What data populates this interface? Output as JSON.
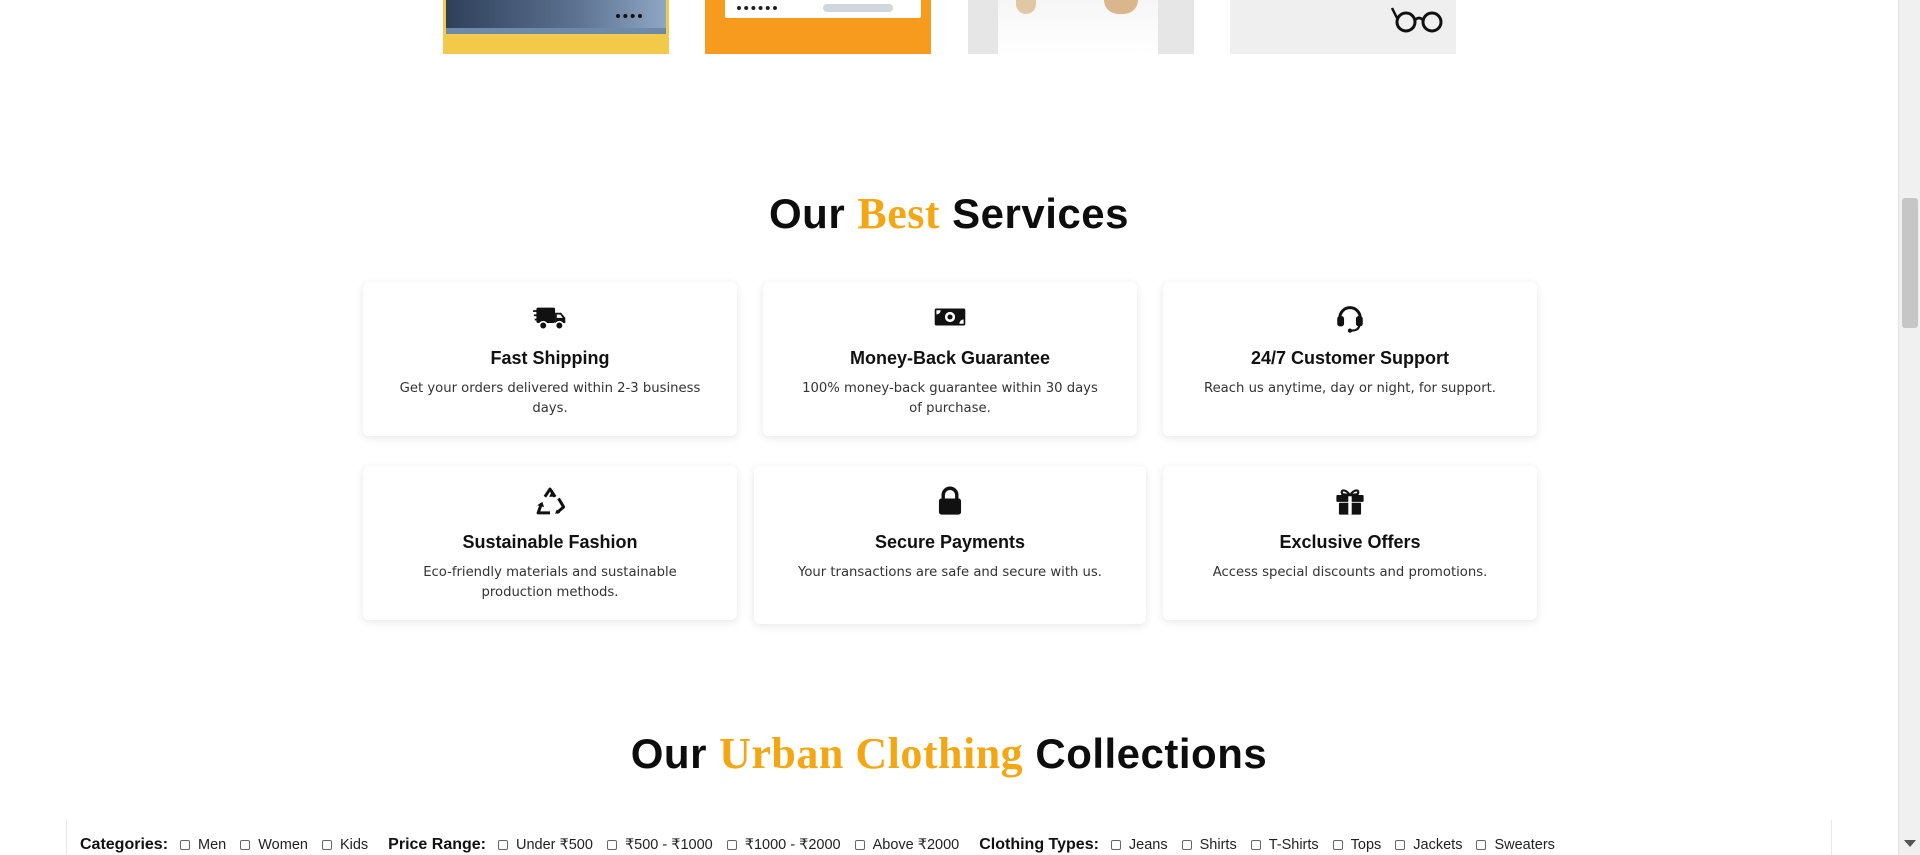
{
  "services": {
    "title_pre": "Our",
    "title_accent": "Best",
    "title_post": "Services",
    "cards": [
      {
        "icon": "truck-icon",
        "title": "Fast Shipping",
        "desc": "Get your orders delivered within 2-3 business days."
      },
      {
        "icon": "money-bill-icon",
        "title": "Money-Back Guarantee",
        "desc": "100% money-back guarantee within 30 days of purchase."
      },
      {
        "icon": "headset-icon",
        "title": "24/7 Customer Support",
        "desc": "Reach us anytime, day or night, for support."
      },
      {
        "icon": "recycle-icon",
        "title": "Sustainable Fashion",
        "desc": "Eco-friendly materials and sustainable production methods."
      },
      {
        "icon": "lock-icon",
        "title": "Secure Payments",
        "desc": "Your transactions are safe and secure with us."
      },
      {
        "icon": "gift-icon",
        "title": "Exclusive Offers",
        "desc": "Access special discounts and promotions."
      }
    ]
  },
  "collections": {
    "title_pre": "Our",
    "title_accent": "Urban Clothing",
    "title_post": "Collections"
  },
  "filters": {
    "categories_label": "Categories:",
    "categories": [
      "Men",
      "Women",
      "Kids"
    ],
    "price_label": "Price Range:",
    "prices": [
      "Under ₹500",
      "₹500 - ₹1000",
      "₹1000 - ₹2000",
      "Above ₹2000"
    ],
    "types_label": "Clothing Types:",
    "types": [
      "Jeans",
      "Shirts",
      "T-Shirts",
      "Tops",
      "Jackets",
      "Sweaters"
    ]
  },
  "colors": {
    "accent": "#f4a714",
    "promo_yellow": "#f3c94a",
    "promo_orange": "#f79b1e"
  }
}
